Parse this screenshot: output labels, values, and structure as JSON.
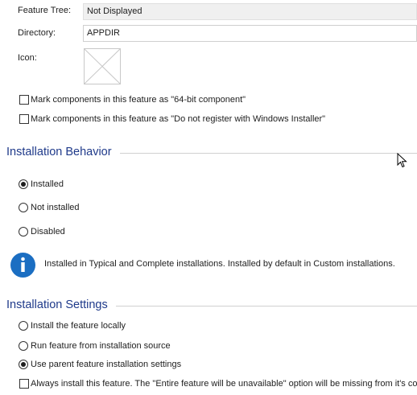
{
  "feature_tree": {
    "label": "Feature Tree:",
    "value": "Not Displayed"
  },
  "directory": {
    "label": "Directory:",
    "value": "APPDIR"
  },
  "icon": {
    "label": "Icon:"
  },
  "checkboxes": {
    "x64": {
      "label": "Mark components in this feature as \"64-bit component\"",
      "checked": false
    },
    "no_register": {
      "label": "Mark components in this feature as \"Do not register with Windows Installer\"",
      "checked": false
    }
  },
  "installation_behavior": {
    "title": "Installation Behavior",
    "options": [
      {
        "label": "Installed",
        "selected": true
      },
      {
        "label": "Not installed",
        "selected": false
      },
      {
        "label": "Disabled",
        "selected": false
      }
    ],
    "info_text": "Installed in Typical and Complete installations. Installed by default in Custom installations."
  },
  "installation_settings": {
    "title": "Installation Settings",
    "options": [
      {
        "label": "Install the feature locally",
        "selected": false
      },
      {
        "label": "Run feature from installation source",
        "selected": false
      },
      {
        "label": "Use parent feature installation settings",
        "selected": true
      }
    ],
    "always_install": {
      "label": "Always install this feature. The \"Entire feature will be unavailable\" option will be missing from it's context menu.",
      "checked": false
    }
  },
  "colors": {
    "accent": "#1f3a8a",
    "info": "#1b6ec2"
  }
}
